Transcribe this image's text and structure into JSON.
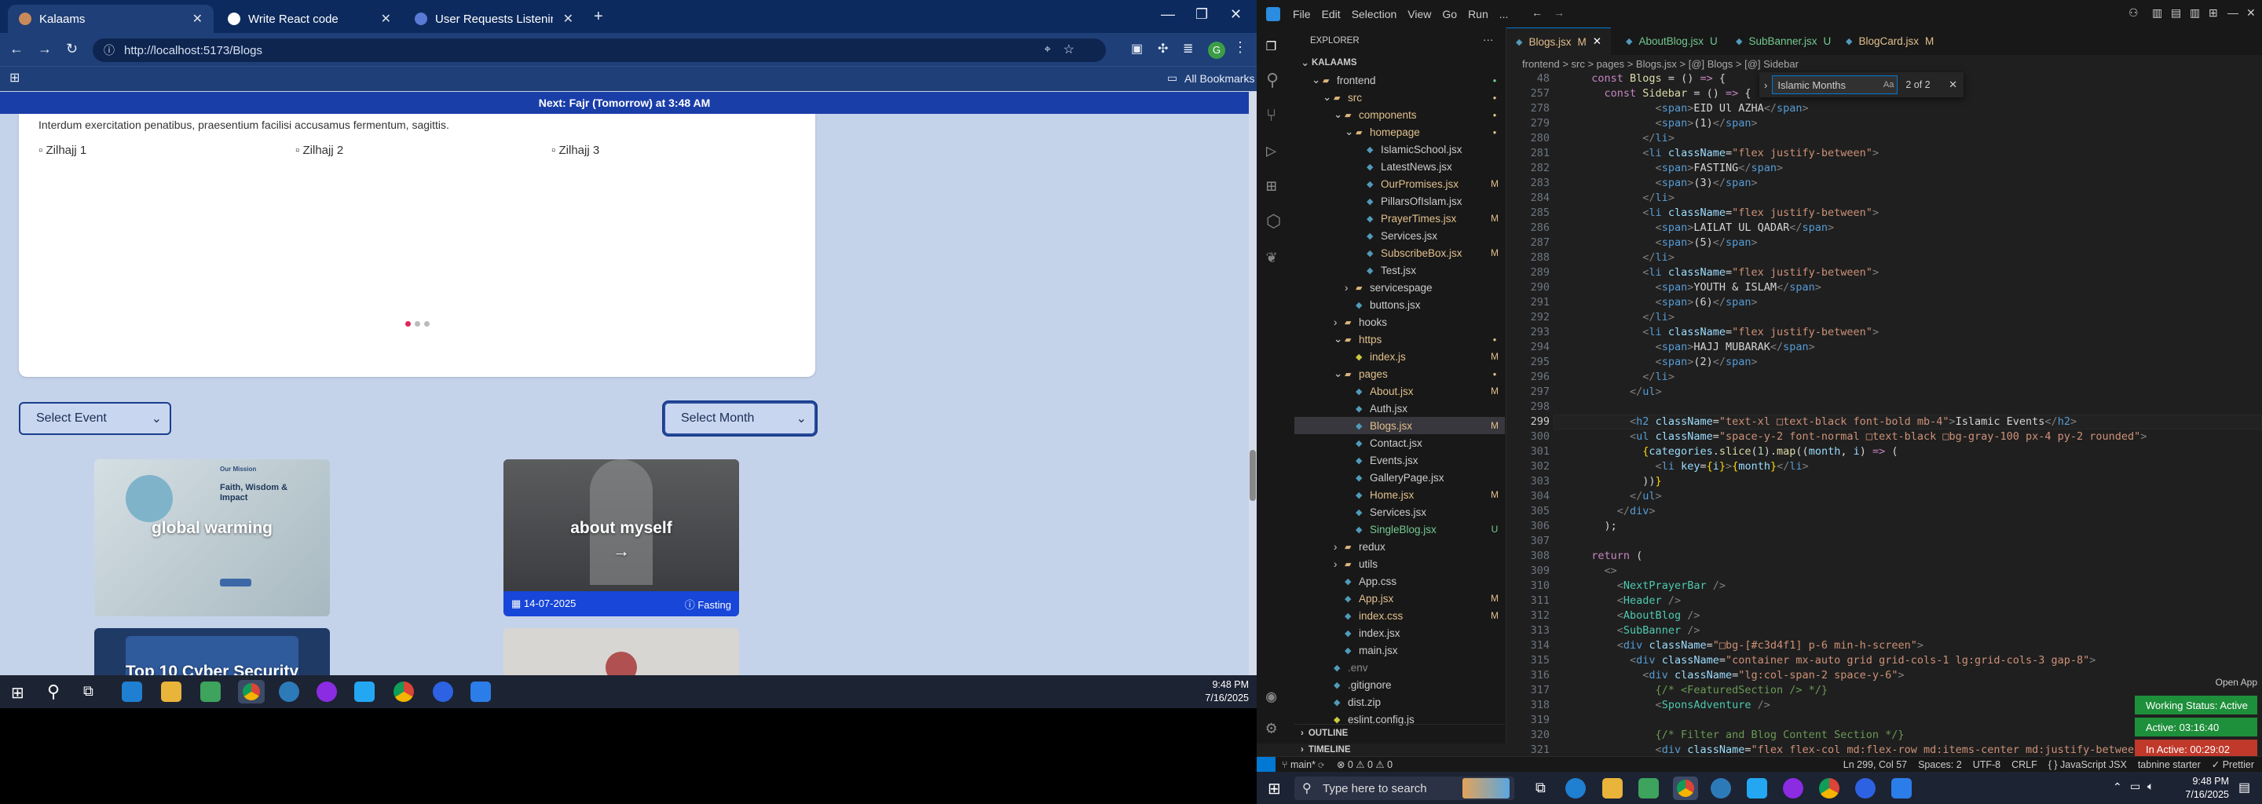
{
  "chrome": {
    "tabs": [
      {
        "label": "Kalaams",
        "active": true
      },
      {
        "label": "Write React code",
        "active": false
      },
      {
        "label": "User Requests Listening Assista",
        "active": false
      }
    ],
    "url": "http://localhost:5173/Blogs",
    "bookmarks_label": "All Bookmarks",
    "profile_initial": "G"
  },
  "page": {
    "prayer_bar": "Next: Fajr (Tomorrow) at 3:48 AM",
    "intro_text": "Interdum exercitation penatibus, praesentium facilisi accusamus fermentum, sagittis.",
    "images": [
      "Zilhajj 1",
      "Zilhajj 2",
      "Zilhajj 3"
    ],
    "select_event": "Select Event",
    "select_month": "Select Month",
    "blogs": [
      {
        "title": "global warming",
        "thumb_heading": "Faith, Wisdom & Impact",
        "thumb_tag": "Our Mission"
      },
      {
        "title": "about myself",
        "arrow": "→",
        "date": "14-07-2025",
        "category": "Fasting"
      },
      {
        "title": "Top 10 Cyber Security"
      },
      {
        "title": ""
      }
    ]
  },
  "vscode": {
    "menu": [
      "File",
      "Edit",
      "Selection",
      "View",
      "Go",
      "Run",
      "..."
    ],
    "explorer_title": "EXPLORER",
    "tree": [
      {
        "label": "KALAAMS",
        "indent": 0,
        "type": "root",
        "status": ""
      },
      {
        "label": "frontend",
        "indent": 1,
        "type": "folder",
        "status": "dot",
        "cls": ""
      },
      {
        "label": "src",
        "indent": 2,
        "type": "folder",
        "status": "dot",
        "cls": "mod"
      },
      {
        "label": "components",
        "indent": 3,
        "type": "folder",
        "status": "dot",
        "cls": "mod"
      },
      {
        "label": "homepage",
        "indent": 4,
        "type": "folder",
        "status": "dot",
        "cls": "mod"
      },
      {
        "label": "IslamicSchool.jsx",
        "indent": 5,
        "type": "file",
        "status": "",
        "cls": ""
      },
      {
        "label": "LatestNews.jsx",
        "indent": 5,
        "type": "file",
        "status": "",
        "cls": ""
      },
      {
        "label": "OurPromises.jsx",
        "indent": 5,
        "type": "file",
        "status": "M",
        "cls": "mod"
      },
      {
        "label": "PillarsOfIslam.jsx",
        "indent": 5,
        "type": "file",
        "status": "",
        "cls": ""
      },
      {
        "label": "PrayerTimes.jsx",
        "indent": 5,
        "type": "file",
        "status": "M",
        "cls": "mod"
      },
      {
        "label": "Services.jsx",
        "indent": 5,
        "type": "file",
        "status": "",
        "cls": ""
      },
      {
        "label": "SubscribeBox.jsx",
        "indent": 5,
        "type": "file",
        "status": "M",
        "cls": "mod"
      },
      {
        "label": "Test.jsx",
        "indent": 5,
        "type": "file",
        "status": "",
        "cls": ""
      },
      {
        "label": "servicespage",
        "indent": 4,
        "type": "folder",
        "status": "",
        "cls": ""
      },
      {
        "label": "buttons.jsx",
        "indent": 4,
        "type": "file",
        "status": "",
        "cls": ""
      },
      {
        "label": "hooks",
        "indent": 3,
        "type": "folder",
        "status": "",
        "cls": ""
      },
      {
        "label": "https",
        "indent": 3,
        "type": "folder",
        "status": "dot",
        "cls": "mod"
      },
      {
        "label": "index.js",
        "indent": 4,
        "type": "file",
        "status": "M",
        "cls": "mod"
      },
      {
        "label": "pages",
        "indent": 3,
        "type": "folder",
        "status": "dot",
        "cls": "mod"
      },
      {
        "label": "About.jsx",
        "indent": 4,
        "type": "file",
        "status": "M",
        "cls": "mod"
      },
      {
        "label": "Auth.jsx",
        "indent": 4,
        "type": "file",
        "status": "",
        "cls": ""
      },
      {
        "label": "Blogs.jsx",
        "indent": 4,
        "type": "file",
        "status": "M",
        "cls": "mod",
        "selected": true
      },
      {
        "label": "Contact.jsx",
        "indent": 4,
        "type": "file",
        "status": "",
        "cls": ""
      },
      {
        "label": "Events.jsx",
        "indent": 4,
        "type": "file",
        "status": "",
        "cls": ""
      },
      {
        "label": "GalleryPage.jsx",
        "indent": 4,
        "type": "file",
        "status": "",
        "cls": ""
      },
      {
        "label": "Home.jsx",
        "indent": 4,
        "type": "file",
        "status": "M",
        "cls": "mod"
      },
      {
        "label": "Services.jsx",
        "indent": 4,
        "type": "file",
        "status": "",
        "cls": ""
      },
      {
        "label": "SingleBlog.jsx",
        "indent": 4,
        "type": "file",
        "status": "U",
        "cls": "untr"
      },
      {
        "label": "redux",
        "indent": 3,
        "type": "folder",
        "status": "",
        "cls": ""
      },
      {
        "label": "utils",
        "indent": 3,
        "type": "folder",
        "status": "",
        "cls": ""
      },
      {
        "label": "App.css",
        "indent": 3,
        "type": "file",
        "status": "",
        "cls": ""
      },
      {
        "label": "App.jsx",
        "indent": 3,
        "type": "file",
        "status": "M",
        "cls": "mod"
      },
      {
        "label": "index.css",
        "indent": 3,
        "type": "file",
        "status": "M",
        "cls": "mod"
      },
      {
        "label": "index.jsx",
        "indent": 3,
        "type": "file",
        "status": "",
        "cls": ""
      },
      {
        "label": "main.jsx",
        "indent": 3,
        "type": "file",
        "status": "",
        "cls": ""
      },
      {
        "label": ".env",
        "indent": 2,
        "type": "file",
        "status": "",
        "cls": "dim"
      },
      {
        "label": ".gitignore",
        "indent": 2,
        "type": "file",
        "status": "",
        "cls": ""
      },
      {
        "label": "dist.zip",
        "indent": 2,
        "type": "file",
        "status": "",
        "cls": ""
      },
      {
        "label": "eslint.config.js",
        "indent": 2,
        "type": "file",
        "status": "",
        "cls": ""
      }
    ],
    "outline_label": "OUTLINE",
    "timeline_label": "TIMELINE",
    "editor_tabs": [
      {
        "label": "Blogs.jsx",
        "status": "M",
        "active": true
      },
      {
        "label": "AboutBlog.jsx",
        "status": "U",
        "active": false
      },
      {
        "label": "SubBanner.jsx",
        "status": "U",
        "active": false
      },
      {
        "label": "BlogCard.jsx",
        "status": "M",
        "active": false
      }
    ],
    "breadcrumbs": "frontend > src > pages > Blogs.jsx > [@] Blogs > [@] Sidebar",
    "find": {
      "query": "Islamic Months",
      "result": "2 of 2"
    },
    "current_line": "299",
    "lines": [
      {
        "n": "48",
        "html": "  <span class='k'>const</span> <span class='f'>Blogs</span> = () <span class='k'>=></span> {"
      },
      {
        "n": "257",
        "html": "    <span class='k'>const</span> <span class='f'>Sidebar</span> = () <span class='k'>=></span> {"
      },
      {
        "n": "278",
        "html": "            <span class='p'>&lt;</span><span class='t'>span</span><span class='p'>&gt;</span>EID Ul AZHA<span class='p'>&lt;/</span><span class='t'>span</span><span class='p'>&gt;</span>"
      },
      {
        "n": "279",
        "html": "            <span class='p'>&lt;</span><span class='t'>span</span><span class='p'>&gt;</span>(1)<span class='p'>&lt;/</span><span class='t'>span</span><span class='p'>&gt;</span>"
      },
      {
        "n": "280",
        "html": "          <span class='p'>&lt;/</span><span class='t'>li</span><span class='p'>&gt;</span>"
      },
      {
        "n": "281",
        "html": "          <span class='p'>&lt;</span><span class='t'>li</span> <span class='a'>className</span>=<span class='s'>\"flex justify-between\"</span><span class='p'>&gt;</span>"
      },
      {
        "n": "282",
        "html": "            <span class='p'>&lt;</span><span class='t'>span</span><span class='p'>&gt;</span>FASTING<span class='p'>&lt;/</span><span class='t'>span</span><span class='p'>&gt;</span>"
      },
      {
        "n": "283",
        "html": "            <span class='p'>&lt;</span><span class='t'>span</span><span class='p'>&gt;</span>(3)<span class='p'>&lt;/</span><span class='t'>span</span><span class='p'>&gt;</span>"
      },
      {
        "n": "284",
        "html": "          <span class='p'>&lt;/</span><span class='t'>li</span><span class='p'>&gt;</span>"
      },
      {
        "n": "285",
        "html": "          <span class='p'>&lt;</span><span class='t'>li</span> <span class='a'>className</span>=<span class='s'>\"flex justify-between\"</span><span class='p'>&gt;</span>"
      },
      {
        "n": "286",
        "html": "            <span class='p'>&lt;</span><span class='t'>span</span><span class='p'>&gt;</span>LAILAT UL QADAR<span class='p'>&lt;/</span><span class='t'>span</span><span class='p'>&gt;</span>"
      },
      {
        "n": "287",
        "html": "            <span class='p'>&lt;</span><span class='t'>span</span><span class='p'>&gt;</span>(5)<span class='p'>&lt;/</span><span class='t'>span</span><span class='p'>&gt;</span>"
      },
      {
        "n": "288",
        "html": "          <span class='p'>&lt;/</span><span class='t'>li</span><span class='p'>&gt;</span>"
      },
      {
        "n": "289",
        "html": "          <span class='p'>&lt;</span><span class='t'>li</span> <span class='a'>className</span>=<span class='s'>\"flex justify-between\"</span><span class='p'>&gt;</span>"
      },
      {
        "n": "290",
        "html": "            <span class='p'>&lt;</span><span class='t'>span</span><span class='p'>&gt;</span>YOUTH &amp; ISLAM<span class='p'>&lt;/</span><span class='t'>span</span><span class='p'>&gt;</span>"
      },
      {
        "n": "291",
        "html": "            <span class='p'>&lt;</span><span class='t'>span</span><span class='p'>&gt;</span>(6)<span class='p'>&lt;/</span><span class='t'>span</span><span class='p'>&gt;</span>"
      },
      {
        "n": "292",
        "html": "          <span class='p'>&lt;/</span><span class='t'>li</span><span class='p'>&gt;</span>"
      },
      {
        "n": "293",
        "html": "          <span class='p'>&lt;</span><span class='t'>li</span> <span class='a'>className</span>=<span class='s'>\"flex justify-between\"</span><span class='p'>&gt;</span>"
      },
      {
        "n": "294",
        "html": "            <span class='p'>&lt;</span><span class='t'>span</span><span class='p'>&gt;</span>HAJJ MUBARAK<span class='p'>&lt;/</span><span class='t'>span</span><span class='p'>&gt;</span>"
      },
      {
        "n": "295",
        "html": "            <span class='p'>&lt;</span><span class='t'>span</span><span class='p'>&gt;</span>(2)<span class='p'>&lt;/</span><span class='t'>span</span><span class='p'>&gt;</span>"
      },
      {
        "n": "296",
        "html": "          <span class='p'>&lt;/</span><span class='t'>li</span><span class='p'>&gt;</span>"
      },
      {
        "n": "297",
        "html": "        <span class='p'>&lt;/</span><span class='t'>ul</span><span class='p'>&gt;</span>"
      },
      {
        "n": "298",
        "html": ""
      },
      {
        "n": "299",
        "html": "        <span class='p'>&lt;</span><span class='t'>h2</span> <span class='a'>className</span>=<span class='s'>\"text-xl &#9633;text-black font-bold mb-4\"</span><span class='p'>&gt;</span>Islamic Events<span class='p'>&lt;/</span><span class='t'>h2</span><span class='p'>&gt;</span>"
      },
      {
        "n": "300",
        "html": "        <span class='p'>&lt;</span><span class='t'>ul</span> <span class='a'>className</span>=<span class='s'>\"space-y-2 font-normal &#9633;text-black &#9633;bg-gray-100 px-4 py-2 rounded\"</span><span class='p'>&gt;</span>"
      },
      {
        "n": "301",
        "html": "          <span class='br'>{</span><span class='a'>categories</span>.<span class='f'>slice</span>(<span class='n'>1</span>).<span class='f'>map</span>((<span class='a'>month</span>, <span class='a'>i</span>) <span class='k'>=></span> ("
      },
      {
        "n": "302",
        "html": "            <span class='p'>&lt;</span><span class='t'>li</span> <span class='a'>key</span>=<span class='br'>{</span><span class='a'>i</span><span class='br'>}</span><span class='p'>&gt;</span><span class='br'>{</span><span class='a'>month</span><span class='br'>}</span><span class='p'>&lt;/</span><span class='t'>li</span><span class='p'>&gt;</span>"
      },
      {
        "n": "303",
        "html": "          ))<span class='br'>}</span>"
      },
      {
        "n": "304",
        "html": "        <span class='p'>&lt;/</span><span class='t'>ul</span><span class='p'>&gt;</span>"
      },
      {
        "n": "305",
        "html": "      <span class='p'>&lt;/</span><span class='t'>div</span><span class='p'>&gt;</span>"
      },
      {
        "n": "306",
        "html": "    );"
      },
      {
        "n": "307",
        "html": ""
      },
      {
        "n": "308",
        "html": "  <span class='k'>return</span> ("
      },
      {
        "n": "309",
        "html": "    <span class='p'>&lt;&gt;</span>"
      },
      {
        "n": "310",
        "html": "      <span class='p'>&lt;</span><span class='c'>NextPrayerBar</span> <span class='p'>/&gt;</span>"
      },
      {
        "n": "311",
        "html": "      <span class='p'>&lt;</span><span class='c'>Header</span> <span class='p'>/&gt;</span>"
      },
      {
        "n": "312",
        "html": "      <span class='p'>&lt;</span><span class='c'>AboutBlog</span> <span class='p'>/&gt;</span>"
      },
      {
        "n": "313",
        "html": "      <span class='p'>&lt;</span><span class='c'>SubBanner</span> <span class='p'>/&gt;</span>"
      },
      {
        "n": "314",
        "html": "      <span class='p'>&lt;</span><span class='t'>div</span> <span class='a'>className</span>=<span class='s'>\"&#9633;bg-[#c3d4f1] p-6 min-h-screen\"</span><span class='p'>&gt;</span>"
      },
      {
        "n": "315",
        "html": "        <span class='p'>&lt;</span><span class='t'>div</span> <span class='a'>className</span>=<span class='s'>\"container mx-auto grid grid-cols-1 lg:grid-cols-3 gap-8\"</span><span class='p'>&gt;</span>"
      },
      {
        "n": "316",
        "html": "          <span class='p'>&lt;</span><span class='t'>div</span> <span class='a'>className</span>=<span class='s'>\"lg:col-span-2 space-y-6\"</span><span class='p'>&gt;</span>"
      },
      {
        "n": "317",
        "html": "            <span class='cm'>{/* &lt;FeaturedSection /&gt; */}</span>"
      },
      {
        "n": "318",
        "html": "            <span class='p'>&lt;</span><span class='c'>SponsAdventure</span> <span class='p'>/&gt;</span>"
      },
      {
        "n": "319",
        "html": ""
      },
      {
        "n": "320",
        "html": "            <span class='cm'>{/* Filter and Blog Content Section */}</span>"
      },
      {
        "n": "321",
        "html": "            <span class='p'>&lt;</span><span class='t'>div</span> <span class='a'>className</span>=<span class='s'>\"flex flex-col md:flex-row md:items-center md:justify-between mb-8 space-</span>"
      }
    ],
    "status": {
      "branch": "main*",
      "problems": "⊗ 0 ⚠ 0 ⚠ 0",
      "position": "Ln 299, Col 57",
      "spaces": "Spaces: 2",
      "encoding": "UTF-8",
      "eol": "CRLF",
      "language": "{ } JavaScript JSX",
      "tabnine": "tabnine starter",
      "prettier": "✓ Prettier"
    },
    "open_app": "Open App",
    "working_status": "Working Status: Active",
    "active_time": "Active: 03:16:40",
    "inactive_time": "In Active: 00:29:02"
  },
  "taskbar1": {
    "time": "9:48 PM",
    "date": "7/16/2025"
  },
  "taskbar2": {
    "search_placeholder": "Type here to search",
    "time": "9:48 PM",
    "date": "7/16/2025"
  }
}
